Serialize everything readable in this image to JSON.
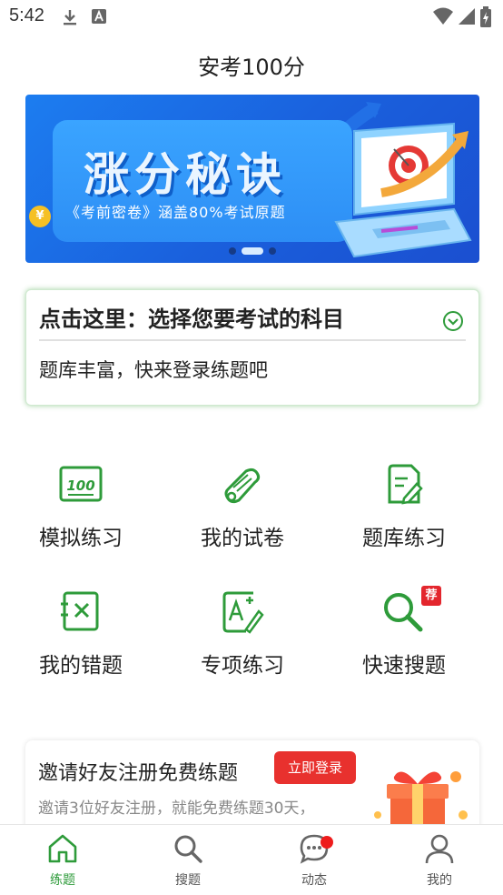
{
  "status_bar": {
    "time": "5:42",
    "icons": [
      "download-icon",
      "a-icon",
      "wifi-icon",
      "signal-icon",
      "battery-icon"
    ]
  },
  "header": {
    "title": "安考100分"
  },
  "banner": {
    "headline": "涨分秘诀",
    "subtitle": "《考前密卷》涵盖80%考试原题",
    "coin_symbol": "¥",
    "colors": {
      "background": "#1a5fdc",
      "panel": "#2d8ef5"
    },
    "carousel": {
      "total": 3,
      "active": 2
    }
  },
  "subject_card": {
    "title": "点击这里：选择您要考试的科目",
    "subtitle": "题库丰富，快来登录练题吧"
  },
  "features": [
    {
      "label": "模拟练习",
      "icon": "score-100-icon"
    },
    {
      "label": "我的试卷",
      "icon": "scroll-icon"
    },
    {
      "label": "题库练习",
      "icon": "edit-document-icon"
    },
    {
      "label": "我的错题",
      "icon": "wrong-question-icon"
    },
    {
      "label": "专项练习",
      "icon": "grade-a-plus-icon"
    },
    {
      "label": "快速搜题",
      "icon": "search-icon",
      "badge": "荐"
    }
  ],
  "invite": {
    "title": "邀请好友注册免费练题",
    "button": "立即登录",
    "subtitle": "邀请3位好友注册，就能免费练题30天，"
  },
  "bottom_nav": {
    "items": [
      {
        "label": "练题",
        "icon": "home-icon",
        "active": true
      },
      {
        "label": "搜题",
        "icon": "search-icon",
        "active": false
      },
      {
        "label": "动态",
        "icon": "chat-icon",
        "active": false,
        "notification_dot": true
      },
      {
        "label": "我的",
        "icon": "user-icon",
        "active": false
      }
    ]
  },
  "colors": {
    "accent": "#2e9b3a",
    "badge": "#e3262d",
    "invite_button": "#e8312e"
  }
}
